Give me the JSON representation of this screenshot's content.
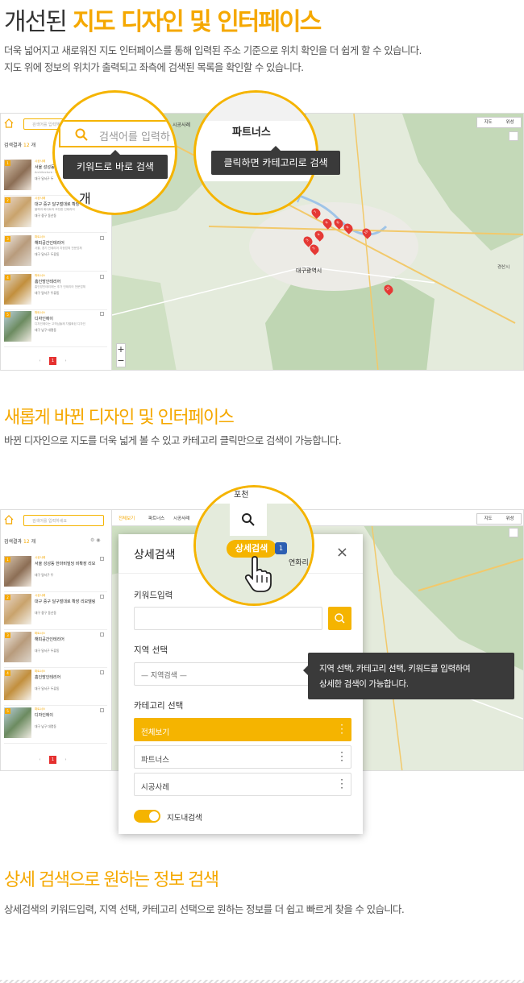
{
  "section1": {
    "title_plain": "개선된",
    "title_accent": "지도 디자인 및 인터페이스",
    "para1": "더욱 넓어지고 새로워진 지도 인터페이스를 통해 입력된 주소 기준으로 위치 확인을 더 쉽게 할 수 있습니다.",
    "para2": "지도 위에 정보의 위치가 출력되고 좌측에 검색된 목록을 확인할 수 있습니다."
  },
  "shot1": {
    "search_placeholder": "검색어를 입력해 주세요",
    "count_label": "검색결과",
    "count_value": "12",
    "count_unit": "개",
    "tab_case": "시공사례",
    "map_type": [
      "지도",
      "위성"
    ],
    "bubble1_placeholder": "검색어를 입력하",
    "bubble1_frag": "개",
    "tip1": "키워드로 바로 검색",
    "bubble2_tab": "파트너스",
    "tip2": "클릭하면 카테고리로 검색",
    "city_label": "대구광역시",
    "city2_label": "경산시",
    "page": "1"
  },
  "list_items": [
    {
      "num": "1",
      "tag": "시공사례",
      "title": "서울 성성동",
      "desc": "Architecture · Interior ·",
      "addr": "대구 달서구 두"
    },
    {
      "num": "2",
      "tag": "시공사례",
      "title": "대구 중구 달구벌대로 확장",
      "desc": "블랙과 화이트의 모던한 인테리어",
      "addr": "대구 중구 동산동"
    },
    {
      "num": "3",
      "tag": "파트너스",
      "title": "해피공간인테리어",
      "desc": "서울, 경기 인테리어 지정업체 전문업체",
      "addr": "대구 달서구 두류동"
    },
    {
      "num": "4",
      "tag": "파트너스",
      "title": "홈인방인테리어",
      "desc": "홈인방인테리어는 추가 인테리어 전문업체",
      "addr": "대구 달서구 두류동"
    },
    {
      "num": "5",
      "tag": "파트너스",
      "title": "디자인에이",
      "desc": "디자인에이는 고객님들께 차별화된 디자인",
      "addr": "대구 남구 대명동"
    }
  ],
  "section2": {
    "title": "새롭게 바뀐 디자인 및 인터페이스",
    "para": "바뀐 디자인으로 지도를 더욱 넓게 볼 수 있고 카테고리 클릭만으로 검색이 가능합니다."
  },
  "shot2": {
    "search_placeholder": "검색어를 입력하세요",
    "count_label": "검색결과",
    "count_value": "12",
    "count_unit": "개",
    "tabs": [
      "전체보기",
      "파트너스",
      "시공사례"
    ],
    "map_type": [
      "지도",
      "위성"
    ],
    "list_titles": [
      "서울 성성동 한마비빌딩 비확장 리모",
      "대구 중구 달구벌대로 확장 리모델링",
      "해피공간인테리어",
      "홈인방인테리어",
      "디자인에이"
    ],
    "bubble_place": "연화리",
    "bubble_top": "포천",
    "bubble_button": "상세검색",
    "bubble_badge": "1",
    "page": "1"
  },
  "modal": {
    "title": "상세검색",
    "close": "×",
    "keyword_label": "키워드입력",
    "keyword_value": "",
    "region_label": "지역 선택",
    "region_value": "— 지역검색 —",
    "category_label": "카테고리 선택",
    "categories": [
      "전체보기",
      "파트너스",
      "시공사례"
    ],
    "toggle_label": "지도내검색",
    "toggle_on": true
  },
  "tip3": {
    "line1": "지역 선택, 카테고리 선택, 키워드를 입력하여",
    "line2": "상세한 검색이 가능합니다."
  },
  "section3": {
    "title": "상세 검색으로 원하는 정보 검색",
    "para": "상세검색의 키워드입력, 지역 선택, 카테고리 선택으로 원하는 정보를 더 쉽고 빠르게 찾을 수 있습니다."
  },
  "colors": {
    "accent": "#f5b400",
    "accent_text": "#f5a800",
    "marker": "#e53935",
    "tooltip": "#3a3a3a"
  }
}
